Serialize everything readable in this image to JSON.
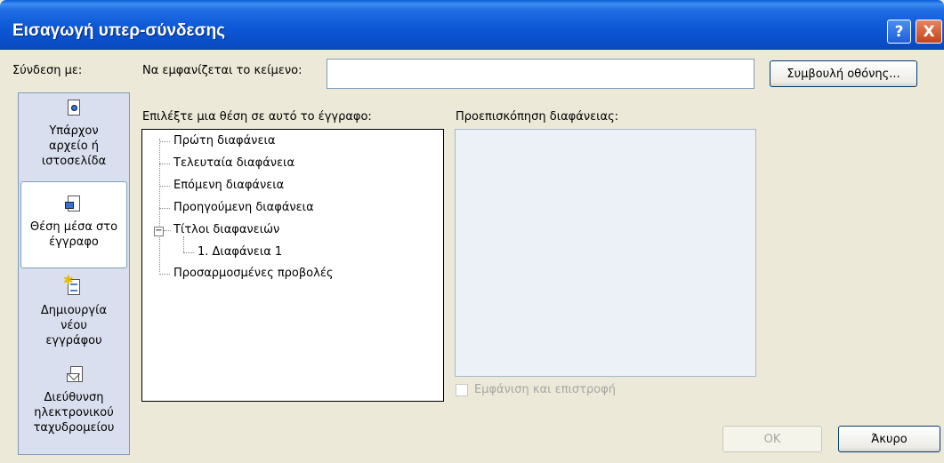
{
  "window": {
    "title": "Εισαγωγή υπερ-σύνδεσης",
    "help_label": "?",
    "close_label": "X"
  },
  "link_to": {
    "label": "Σύνδεση με:",
    "items": [
      {
        "icon": "existing-file-icon",
        "label": "Υπάρχον αρχείο ή ιστοσελίδα",
        "selected": false
      },
      {
        "icon": "place-in-document-icon",
        "label": "Θέση μέσα στο έγγραφο",
        "selected": true
      },
      {
        "icon": "new-document-icon",
        "label": "Δημιουργία νέου εγγράφου",
        "selected": false
      },
      {
        "icon": "email-address-icon",
        "label": "Διεύθυνση ηλεκτρονικού ταχυδρομείου",
        "selected": false
      }
    ]
  },
  "display_text": {
    "label": "Να εμφανίζεται το κείμενο:",
    "value": ""
  },
  "screentip_label": "Συμβουλή οθόνης...",
  "place_select": {
    "label": "Επιλέξτε μια θέση σε αυτό το έγγραφο:",
    "items": [
      "Πρώτη διαφάνεια",
      "Τελευταία διαφάνεια",
      "Επόμενη διαφάνεια",
      "Προηγούμενη διαφάνεια",
      "Τίτλοι διαφανειών",
      "1. Διαφάνεια 1",
      "Προσαρμοσμένες προβολές"
    ]
  },
  "preview": {
    "label": "Προεπισκόπηση διαφάνειας:",
    "show_return_label": "Εμφάνιση και επιστροφή"
  },
  "buttons": {
    "ok": "OK",
    "cancel": "Άκυρο"
  }
}
